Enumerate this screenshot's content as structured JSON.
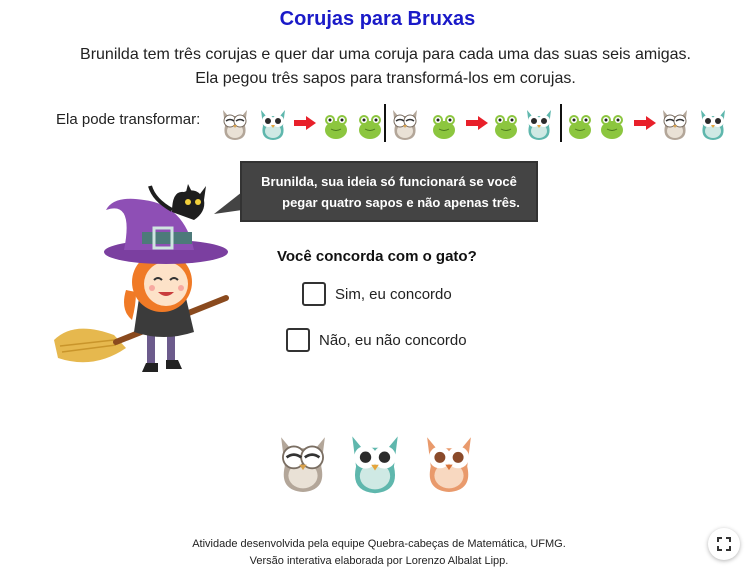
{
  "header": {
    "title": "Corujas para Bruxas"
  },
  "intro": {
    "line1": "Brunilda tem três corujas e quer dar uma coruja para cada uma das suas seis amigas.",
    "line2": "Ela pegou três sapos para transformá-los em corujas."
  },
  "transform": {
    "label": "Ela pode transformar:",
    "sequence": [
      "owl-gray-icon",
      "owl-teal-icon",
      "red-arrow-icon",
      "frog-icon",
      "frog-icon",
      "separator",
      "owl-gray-icon",
      "frog-icon",
      "red-arrow-icon",
      "frog-icon",
      "owl-teal-icon",
      "separator",
      "frog-icon",
      "frog-icon",
      "red-arrow-icon",
      "owl-gray-icon",
      "owl-teal-icon"
    ]
  },
  "bubble": {
    "line1": "Brunilda, sua ideia só funcionará se você",
    "line2": "pegar quatro sapos e não apenas três."
  },
  "quiz": {
    "question": "Você concorda com o gato?",
    "options": [
      {
        "label": "Sim, eu concordo",
        "checked": false
      },
      {
        "label": "Não, eu não concordo",
        "checked": false
      }
    ]
  },
  "owls": [
    "owl-gray-icon",
    "owl-teal-icon",
    "owl-orange-icon"
  ],
  "colors": {
    "title": "#1a1ac8",
    "bubble": "#444444",
    "arrow": "#e8202a",
    "owl_gray": "#b3a699",
    "owl_teal": "#5fb7ad",
    "owl_orange": "#e99a6c",
    "frog": "#8cc63f"
  },
  "credits": {
    "line1": "Atividade desenvolvida pela equipe Quebra-cabeças de Matemática, UFMG.",
    "line2": "Versão interativa elaborada por Lorenzo Albalat Lipp."
  },
  "controls": {
    "fullscreen_icon": "fullscreen-icon"
  }
}
